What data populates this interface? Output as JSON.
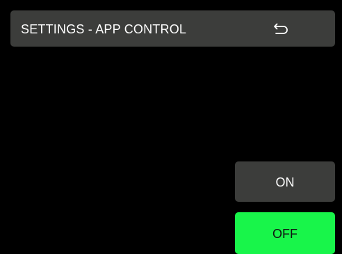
{
  "header": {
    "title": "SETTINGS - APP CONTROL",
    "back_icon": "back-arrow-icon"
  },
  "controls": {
    "on_label": "ON",
    "off_label": "OFF",
    "selected": "OFF"
  },
  "colors": {
    "background": "#000000",
    "panel": "#3c3d3b",
    "active": "#18f54a",
    "text": "#ffffff"
  }
}
